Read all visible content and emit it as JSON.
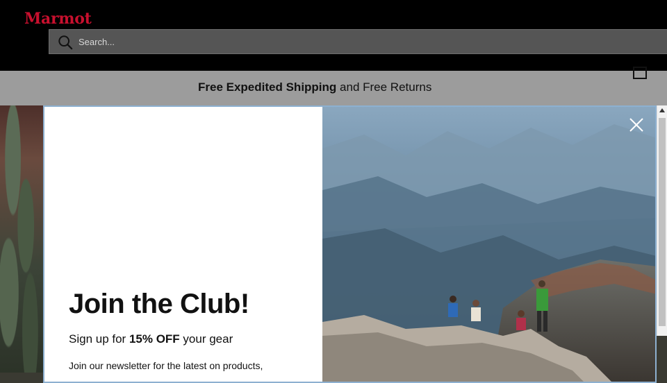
{
  "header": {
    "logo": "Marmot",
    "search": {
      "placeholder": "Search..."
    },
    "icons": {
      "search": "search-icon",
      "cart": "shopping-bag-icon"
    }
  },
  "promo": {
    "bold": "Free Expedited Shipping",
    "rest": " and Free Returns"
  },
  "modal": {
    "title": "Join the Club!",
    "subtitle_pre": "Sign up for ",
    "subtitle_bold": "15% OFF",
    "subtitle_post": " your gear",
    "newsletter_text": "Join our newsletter for the latest on products,",
    "close_icon": "close-icon",
    "photo_alt": "hikers"
  },
  "colors": {
    "brand": "#c8102e",
    "header_bg": "#000000",
    "promo_bg": "#9c9c9c",
    "modal_border": "#8db0d0"
  }
}
